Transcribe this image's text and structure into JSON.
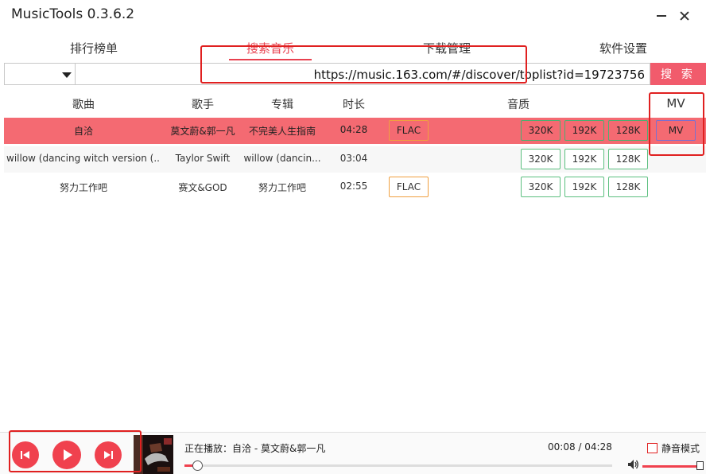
{
  "window": {
    "title": "MusicTools 0.3.6.2",
    "minimize_label": "—",
    "close_label": "✕"
  },
  "tabs": [
    {
      "label": "排行榜单",
      "active": false
    },
    {
      "label": "搜索音乐",
      "active": true
    },
    {
      "label": "下载管理",
      "active": false
    },
    {
      "label": "软件设置",
      "active": false
    }
  ],
  "search": {
    "source_value": "",
    "url_value": "https://music.163.com/#/discover/toplist?id=19723756",
    "button_label": "搜 索"
  },
  "table": {
    "columns": [
      "歌曲",
      "歌手",
      "专辑",
      "时长",
      "音质",
      "MV"
    ],
    "rows": [
      {
        "song": "自洽",
        "artist": "莫文蔚&郭一凡",
        "album": "不完美人生指南",
        "duration": "04:28",
        "flac": "FLAC",
        "q320": "320K",
        "q192": "192K",
        "q128": "128K",
        "mv": "MV",
        "selected": true
      },
      {
        "song": "willow (dancing witch version (...",
        "artist": "Taylor Swift",
        "album": "willow (dancin...",
        "duration": "03:04",
        "flac": "",
        "q320": "320K",
        "q192": "192K",
        "q128": "128K",
        "mv": "",
        "selected": false
      },
      {
        "song": "努力工作吧",
        "artist": "赛文&GOD",
        "album": "努力工作吧",
        "duration": "02:55",
        "flac": "FLAC",
        "q320": "320K",
        "q192": "192K",
        "q128": "128K",
        "mv": "",
        "selected": false
      }
    ]
  },
  "player": {
    "now_playing": "正在播放：自洽 - 莫文蔚&郭一凡",
    "time": "00:08 / 04:28",
    "progress": 0.03,
    "mute_label": "静音模式",
    "muted": false,
    "volume": 1.0
  },
  "colors": {
    "accent": "#e8414f",
    "selected_row": "#f46a72",
    "quality_border": "#5bbf7f",
    "flac_border": "#f0a040"
  }
}
